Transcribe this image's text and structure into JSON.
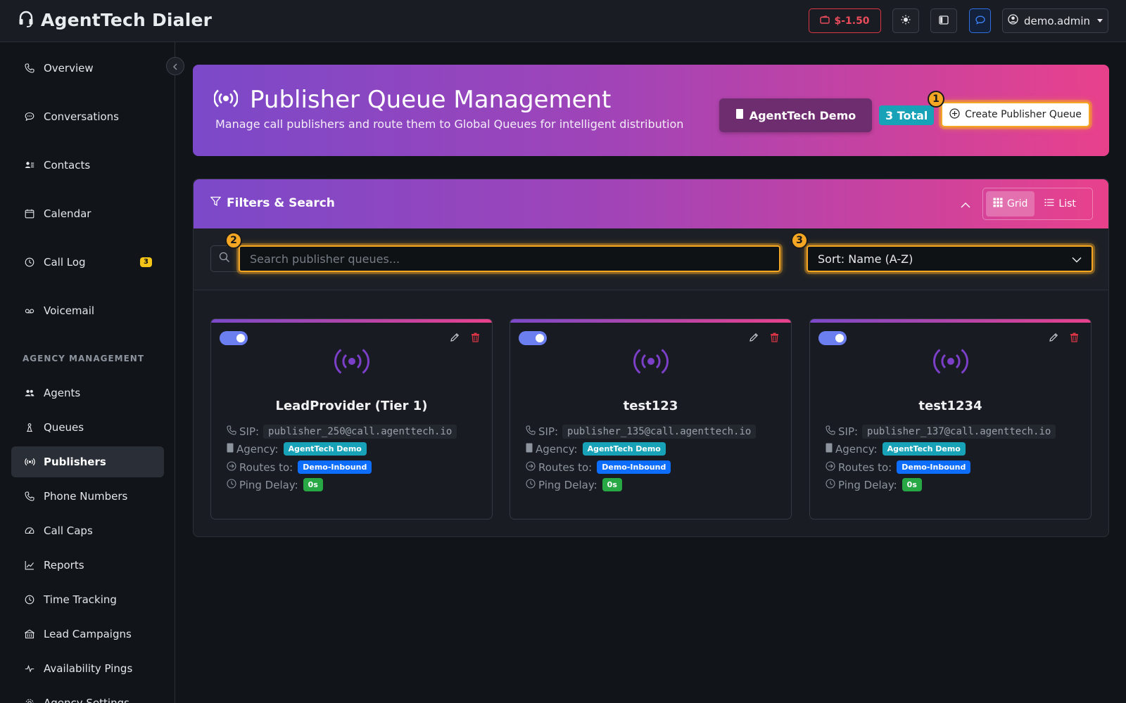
{
  "topbar": {
    "app_title": "AgentTech Dialer",
    "balance": "$-1.50",
    "username": "demo.admin"
  },
  "sidebar": {
    "items": [
      {
        "label": "Overview",
        "icon": "phone-icon"
      },
      {
        "label": "Conversations",
        "icon": "chat-icon"
      },
      {
        "label": "Contacts",
        "icon": "contacts-icon"
      },
      {
        "label": "Calendar",
        "icon": "calendar-icon"
      },
      {
        "label": "Call Log",
        "icon": "clock-icon",
        "badge": "3"
      },
      {
        "label": "Voicemail",
        "icon": "voicemail-icon"
      }
    ],
    "section_label": "AGENCY MANAGEMENT",
    "agency_items": [
      {
        "label": "Agents",
        "icon": "people-icon"
      },
      {
        "label": "Queues",
        "icon": "queue-icon"
      },
      {
        "label": "Publishers",
        "icon": "broadcast-icon",
        "active": true
      },
      {
        "label": "Phone Numbers",
        "icon": "phone-icon"
      },
      {
        "label": "Call Caps",
        "icon": "speedometer-icon"
      },
      {
        "label": "Reports",
        "icon": "chart-icon"
      },
      {
        "label": "Time Tracking",
        "icon": "clock-icon"
      },
      {
        "label": "Lead Campaigns",
        "icon": "building-icon"
      },
      {
        "label": "Availability Pings",
        "icon": "pulse-icon"
      },
      {
        "label": "Agency Settings",
        "icon": "gear-icon"
      }
    ]
  },
  "header": {
    "title": "Publisher Queue Management",
    "subtitle": "Manage call publishers and route them to Global Queues for intelligent distribution",
    "agency_button": "AgentTech Demo",
    "total_badge": "3 Total",
    "create_button": "Create Publisher Queue"
  },
  "markers": [
    "1",
    "2",
    "3"
  ],
  "filters": {
    "title": "Filters & Search",
    "view_grid": "Grid",
    "view_list": "List",
    "search_placeholder": "Search publisher queues...",
    "sort_value": "Sort: Name (A-Z)"
  },
  "labels": {
    "sip": "SIP:",
    "agency": "Agency:",
    "routes_to": "Routes to:",
    "ping_delay": "Ping Delay:"
  },
  "cards": [
    {
      "name": "LeadProvider (Tier 1)",
      "sip": "publisher_250@call.agenttech.io",
      "agency": "AgentTech Demo",
      "routes_to": "Demo-Inbound",
      "ping_delay": "0s",
      "enabled": true
    },
    {
      "name": "test123",
      "sip": "publisher_135@call.agenttech.io",
      "agency": "AgentTech Demo",
      "routes_to": "Demo-Inbound",
      "ping_delay": "0s",
      "enabled": true
    },
    {
      "name": "test1234",
      "sip": "publisher_137@call.agenttech.io",
      "agency": "AgentTech Demo",
      "routes_to": "Demo-Inbound",
      "ping_delay": "0s",
      "enabled": true
    }
  ],
  "colors": {
    "accent_start": "#7b49c9",
    "accent_end": "#e8418c",
    "highlight": "#f5a623",
    "danger": "#dc3545"
  }
}
